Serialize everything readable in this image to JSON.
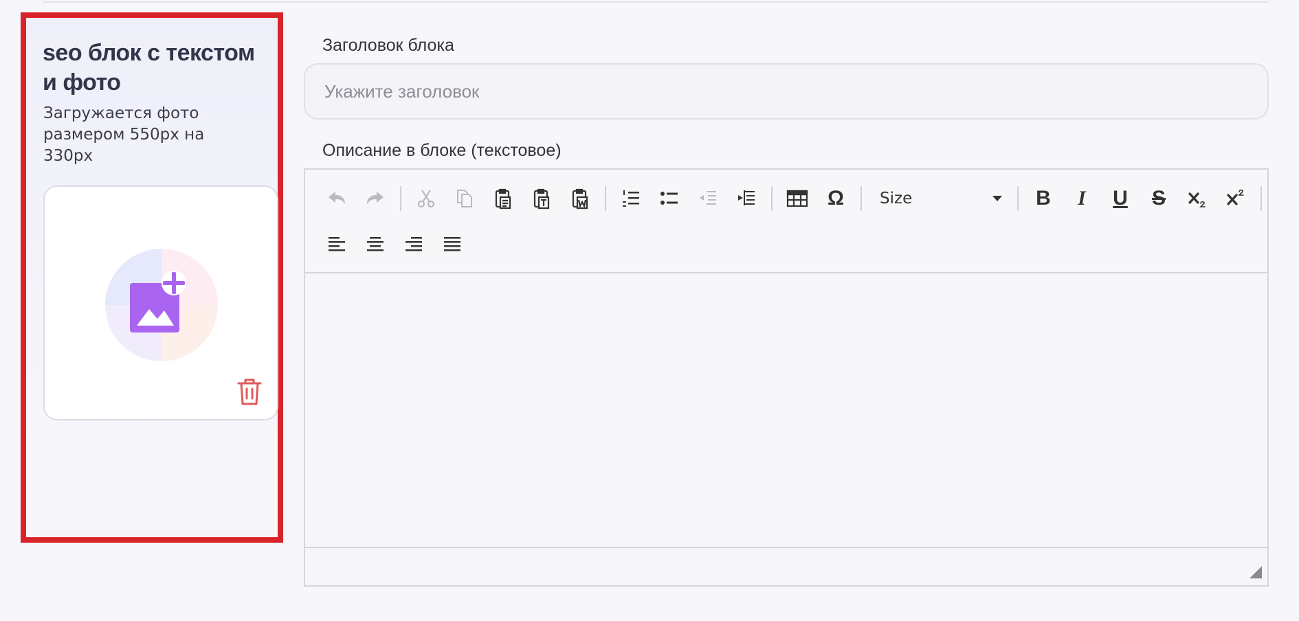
{
  "block": {
    "title": "seo блок с текстом и фото",
    "description": "Загружается фото размером 550px на 330px"
  },
  "photo_upload": {
    "upload_icon": "add-image-icon",
    "delete_icon": "trash-icon",
    "accent_color": "#a964f0",
    "delete_color": "#e05a5a"
  },
  "fields": {
    "title_label": "Заголовок блока",
    "title_placeholder": "Укажите заголовок",
    "description_label": "Описание в блоке (текстовое)"
  },
  "editor": {
    "font_size_select": "Size",
    "buttons": {
      "bold": "B",
      "italic": "I",
      "underline": "U",
      "strike": "S",
      "special_char": "Ω"
    }
  },
  "colors": {
    "highlight_border": "#d9232b",
    "page_background": "#f7f7fb"
  }
}
